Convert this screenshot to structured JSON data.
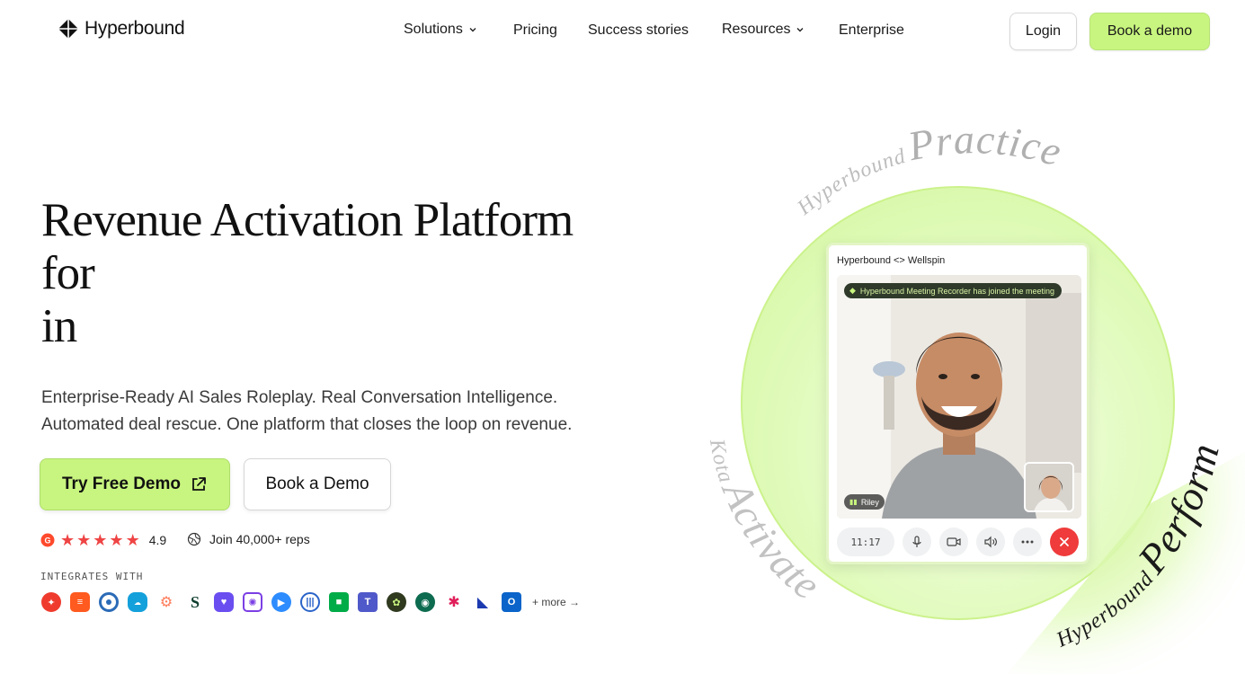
{
  "header": {
    "logo_text": "Hyperbound",
    "nav": [
      {
        "label": "Solutions",
        "has_dropdown": true
      },
      {
        "label": "Pricing",
        "has_dropdown": false
      },
      {
        "label": "Success stories",
        "has_dropdown": false
      },
      {
        "label": "Resources",
        "has_dropdown": true
      },
      {
        "label": "Enterprise",
        "has_dropdown": false
      }
    ],
    "login_label": "Login",
    "book_demo_label": "Book a demo"
  },
  "hero": {
    "headline_line1": "Revenue Activation Platform",
    "headline_line2": "for",
    "headline_line3": "in",
    "subtext_line1": "Enterprise-Ready AI Sales Roleplay. Real Conversation Intelligence.",
    "subtext_line2": "Automated deal rescue. One platform that closes the loop on revenue.",
    "try_demo_label": "Try Free Demo",
    "book_demo_label": "Book a Demo",
    "rating_value": "4.9",
    "join_text": "Join 40,000+ reps",
    "integrates_label": "INTEGRATES WITH",
    "more_label": "+ more →",
    "integration_icons": [
      "apollo-icon",
      "outreach-icon",
      "gong-icon",
      "salesforce-icon",
      "hubspot-icon",
      "salesloft-icon",
      "vidyard-icon",
      "clari-icon",
      "zoom-icon",
      "chorus-icon",
      "google-meet-icon",
      "teams-icon",
      "integration-13-icon",
      "integration-14-icon",
      "slack-icon",
      "dynamics-icon",
      "outlook-icon"
    ]
  },
  "visual": {
    "curved_practice_prefix": "Hyperbound",
    "curved_practice": "Practice",
    "curved_activate_prefix": "Kota",
    "curved_activate": "Activate",
    "curved_perform_prefix": "Hyperbound",
    "curved_perform": "Perform",
    "card_title": "Hyperbound <> Wellspin",
    "notice": "Hyperbound Meeting Recorder has joined the meeting",
    "participant_name": "Riley",
    "timer": "11:17"
  },
  "colors": {
    "accent": "#c8f57f",
    "accent_border": "#aedd6a",
    "end_call": "#ef3b3b",
    "star": "#ef4444"
  }
}
